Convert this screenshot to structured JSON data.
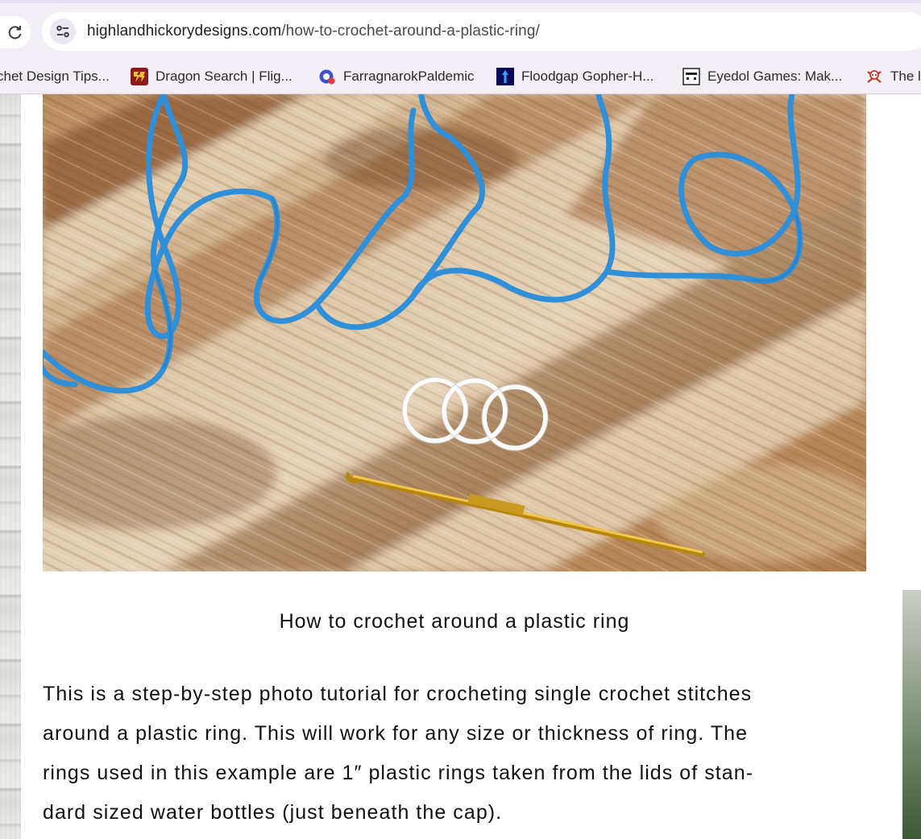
{
  "browser": {
    "url_domain": "highlandhickorydesigns.com",
    "url_path": "/how-to-crochet-around-a-plastic-ring/",
    "bookmarks": [
      {
        "label": "chet Design Tips...",
        "icon": "none"
      },
      {
        "label": "Dragon Search | Flig...",
        "icon": "dragon-search-icon"
      },
      {
        "label": "FarragnarokPaldemic",
        "icon": "farragnarok-icon"
      },
      {
        "label": "Floodgap Gopher-H...",
        "icon": "floodgap-icon"
      },
      {
        "label": "Eyedol Games: Mak...",
        "icon": "eyedol-icon"
      },
      {
        "label": "The l",
        "icon": "skull-crossbones-icon"
      }
    ]
  },
  "article": {
    "image_alt": "Blue yarn, three white plastic rings and a gold crochet hook on a wooden surface",
    "caption": "How to crochet around a plastic ring",
    "paragraph_lines": [
      "This is a step-by-step photo tutorial for crocheting single crochet stitches",
      "around a plastic ring. This will work for any size or thickness of ring. The",
      "rings used in this example are 1″ plastic rings taken from the lids of stan-",
      "dard sized water bottles (just beneath the cap)."
    ]
  },
  "colors": {
    "chrome_bg": "#f4eef7",
    "yarn": "#2f8fd8",
    "wood_light": "#d9c3a3",
    "wood_dark": "#8a5a33"
  }
}
